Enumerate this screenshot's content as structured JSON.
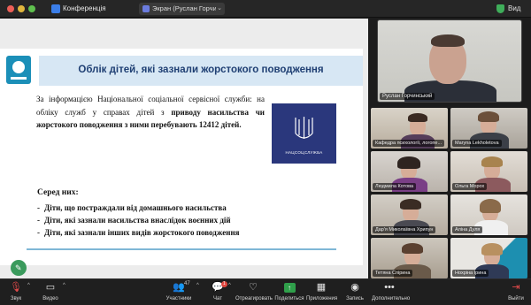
{
  "titlebar": {
    "app_title": "Конференція",
    "screen_chip": "Экран (Руслан Горчинський)",
    "view_label": "Вид"
  },
  "slide": {
    "title": "Облік дітей, які зазнали жорстокого поводження",
    "body_part1": "За інформацією Національної соціальної сервісної служби: на обліку служб у справах дітей з ",
    "body_bold1": "приводу насильства чи жорстокого поводження з ними перебувають 12412 дітей.",
    "logo_text": "НАЦСОЦСЛУЖБА",
    "among_label": "Серед них:",
    "bullets": [
      "Діти, що постраждали від домашнього насильства",
      "Діти, які зазнали насильства внаслідок воєнних дій",
      "Діти, які зазнали інших видів жорстокого поводження"
    ]
  },
  "speaker": {
    "name": "Руслан Горчинський"
  },
  "participants": [
    {
      "name": "Кафедра психології, логопе..."
    },
    {
      "name": "Maryna Lekholetova"
    },
    {
      "name": "Людмила Котова"
    },
    {
      "name": "Ольга Морох"
    },
    {
      "name": "Дар'я Миколаївна Хрипун"
    },
    {
      "name": "Аліна Дуля"
    },
    {
      "name": "Тетяна Спірина"
    },
    {
      "name": "Нохріна Ірина"
    }
  ],
  "toolbar": {
    "mic_label": "Звук",
    "video_label": "Видео",
    "participants_label": "Участники",
    "participants_count": "47",
    "chat_label": "Чат",
    "chat_badge": "1",
    "reactions_label": "Отреагировать",
    "share_label": "Поделиться",
    "apps_label": "Приложения",
    "record_label": "Запись",
    "more_label": "Дополнительно",
    "leave_label": "Выйти"
  }
}
